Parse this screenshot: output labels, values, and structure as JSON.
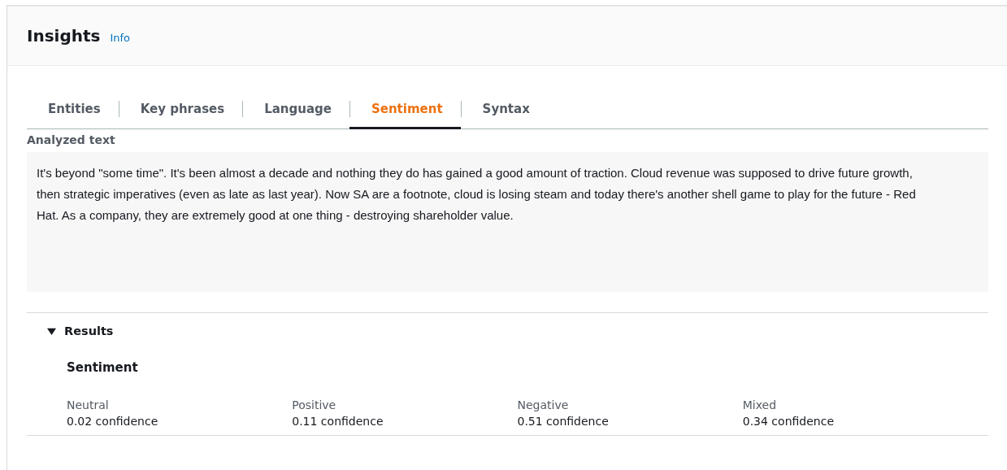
{
  "header": {
    "title": "Insights",
    "info_link": "Info"
  },
  "tabs": [
    {
      "label": "Entities",
      "selected": false
    },
    {
      "label": "Key phrases",
      "selected": false
    },
    {
      "label": "Language",
      "selected": false
    },
    {
      "label": "Sentiment",
      "selected": true
    },
    {
      "label": "Syntax",
      "selected": false
    }
  ],
  "analyzed_text": {
    "label": "Analyzed text",
    "text": "It's beyond \"some time\". It's been almost a decade and nothing they do has gained a good amount of traction. Cloud revenue was supposed to drive future growth, then strategic imperatives (even as late as last year). Now SA are a footnote, cloud is losing steam and today there's another shell game to play for the future - Red Hat. As a company, they are extremely good at one thing - destroying shareholder value."
  },
  "results": {
    "title": "Results",
    "expanded": true,
    "section_title": "Sentiment",
    "scores": [
      {
        "label": "Neutral",
        "value": "0.02 confidence"
      },
      {
        "label": "Positive",
        "value": "0.11 confidence"
      },
      {
        "label": "Negative",
        "value": "0.51 confidence"
      },
      {
        "label": "Mixed",
        "value": "0.34 confidence"
      }
    ]
  }
}
